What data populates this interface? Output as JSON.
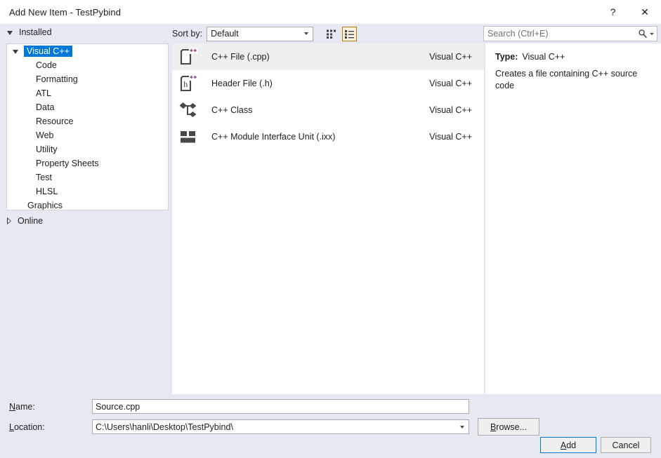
{
  "window": {
    "title": "Add New Item - TestPybind",
    "help_label": "?",
    "close_label": "✕"
  },
  "left": {
    "installed_label": "Installed",
    "online_label": "Online",
    "tree": [
      {
        "label": "Visual C++",
        "level": 0,
        "expanded": true,
        "selected": true
      },
      {
        "label": "Code",
        "level": 1,
        "expanded": false,
        "selected": false
      },
      {
        "label": "Formatting",
        "level": 1,
        "expanded": false,
        "selected": false
      },
      {
        "label": "ATL",
        "level": 1,
        "expanded": false,
        "selected": false
      },
      {
        "label": "Data",
        "level": 1,
        "expanded": false,
        "selected": false
      },
      {
        "label": "Resource",
        "level": 1,
        "expanded": false,
        "selected": false
      },
      {
        "label": "Web",
        "level": 1,
        "expanded": false,
        "selected": false
      },
      {
        "label": "Utility",
        "level": 1,
        "expanded": false,
        "selected": false
      },
      {
        "label": "Property Sheets",
        "level": 1,
        "expanded": false,
        "selected": false
      },
      {
        "label": "Test",
        "level": 1,
        "expanded": false,
        "selected": false
      },
      {
        "label": "HLSL",
        "level": 1,
        "expanded": false,
        "selected": false
      },
      {
        "label": "Graphics",
        "level": 0,
        "expanded": false,
        "selected": false
      }
    ]
  },
  "toolbar": {
    "sort_by_label": "Sort by:",
    "sort_value": "Default",
    "sort_options": [
      "Default"
    ],
    "view_small_icons": "small-icons-view",
    "view_list": "list-view",
    "selected_view": "list-view"
  },
  "search": {
    "placeholder": "Search (Ctrl+E)",
    "value": "",
    "icon": "search-icon"
  },
  "items": [
    {
      "name": "C++ File (.cpp)",
      "kind": "Visual C++",
      "icon": "cpp-file-icon",
      "selected": true
    },
    {
      "name": "Header File (.h)",
      "kind": "Visual C++",
      "icon": "header-file-icon",
      "selected": false
    },
    {
      "name": "C++ Class",
      "kind": "Visual C++",
      "icon": "cpp-class-icon",
      "selected": false
    },
    {
      "name": "C++ Module Interface Unit (.ixx)",
      "kind": "Visual C++",
      "icon": "module-unit-icon",
      "selected": false
    }
  ],
  "detail": {
    "type_label": "Type:",
    "type_value": "Visual C++",
    "description": "Creates a file containing C++ source code"
  },
  "form": {
    "name_label_pre": "N",
    "name_label_post": "ame:",
    "name_value": "Source.cpp",
    "location_label_pre": "L",
    "location_label_post": "ocation:",
    "location_value": "C:\\Users\\hanli\\Desktop\\TestPybind\\",
    "browse_label_pre": "B",
    "browse_label_post": "rowse...",
    "add_label_pre": "A",
    "add_label_post": "dd",
    "cancel_label": "Cancel"
  },
  "colors": {
    "dialog_bg": "#e6e9f2",
    "panel_bg": "#ffffff",
    "selection_blue": "#0078d7",
    "row_selected": "#efefef",
    "toggle_selected_border": "#c07800",
    "toggle_selected_bg": "#fdf3dc",
    "icon_dark": "#484848",
    "icon_purple": "#9b4f96",
    "focus_border": "#0078d7"
  }
}
